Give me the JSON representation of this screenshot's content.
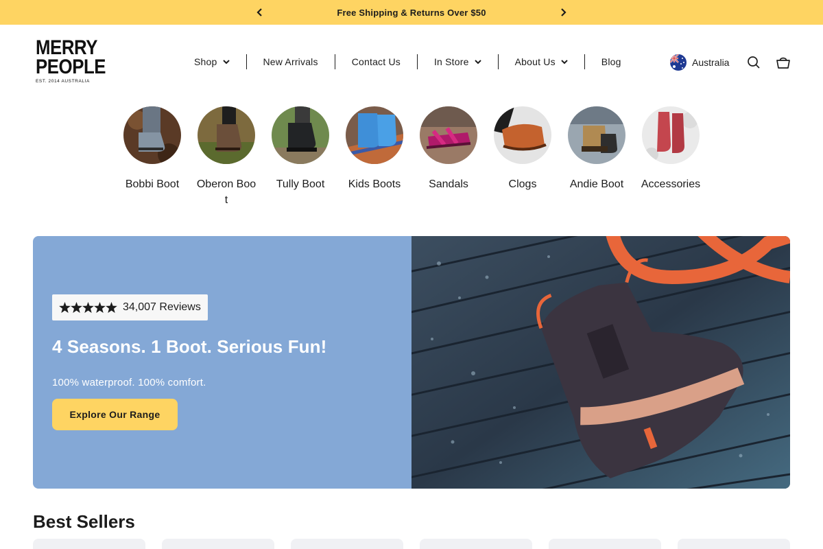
{
  "announcement": {
    "text": "Free Shipping & Returns Over $50"
  },
  "brand": {
    "logo_line1": "MERRY",
    "logo_line2": "PEOPLE",
    "logo_tagline": "EST. 2014 AUSTRALIA"
  },
  "nav": {
    "items": [
      {
        "label": "Shop",
        "dropdown": true
      },
      {
        "label": "New Arrivals",
        "dropdown": false
      },
      {
        "label": "Contact Us",
        "dropdown": false
      },
      {
        "label": "In Store",
        "dropdown": true
      },
      {
        "label": "About Us",
        "dropdown": true
      },
      {
        "label": "Blog",
        "dropdown": false
      }
    ]
  },
  "header": {
    "locale_label": "Australia"
  },
  "categories": [
    {
      "label": "Bobbi Boot"
    },
    {
      "label": "Oberon Boot"
    },
    {
      "label": "Tully Boot"
    },
    {
      "label": "Kids Boots"
    },
    {
      "label": "Sandals"
    },
    {
      "label": "Clogs"
    },
    {
      "label": "Andie Boot"
    },
    {
      "label": "Accessories"
    }
  ],
  "hero": {
    "rating_stars": 5,
    "reviews_text": "34,007 Reviews",
    "title": "4 Seasons. 1 Boot. Serious Fun!",
    "subtitle": "100% waterproof. 100% comfort.",
    "cta_label": "Explore Our Range"
  },
  "best_sellers": {
    "title": "Best Sellers"
  },
  "colors": {
    "announcement_bg": "#fed462",
    "hero_panel_bg": "#84a8d6",
    "cta_bg": "#fed462",
    "text": "#1c1c1c"
  }
}
